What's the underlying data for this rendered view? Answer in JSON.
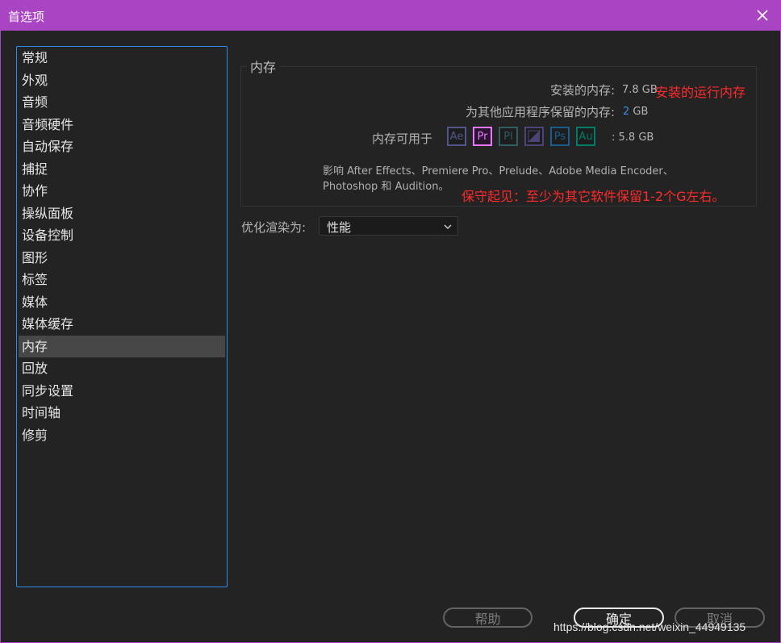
{
  "window": {
    "title": "首选项"
  },
  "sidebar": {
    "items": [
      {
        "label": "常规"
      },
      {
        "label": "外观"
      },
      {
        "label": "音频"
      },
      {
        "label": "音频硬件"
      },
      {
        "label": "自动保存"
      },
      {
        "label": "捕捉"
      },
      {
        "label": "协作"
      },
      {
        "label": "操纵面板"
      },
      {
        "label": "设备控制"
      },
      {
        "label": "图形"
      },
      {
        "label": "标签"
      },
      {
        "label": "媒体"
      },
      {
        "label": "媒体缓存"
      },
      {
        "label": "内存"
      },
      {
        "label": "回放"
      },
      {
        "label": "同步设置"
      },
      {
        "label": "时间轴"
      },
      {
        "label": "修剪"
      }
    ],
    "selected_index": 13
  },
  "memory": {
    "group_title": "内存",
    "installed_label": "安装的内存:",
    "installed_value": "7.8 GB",
    "reserved_label": "为其他应用程序保留的内存:",
    "reserved_value": "2",
    "reserved_unit": "GB",
    "available_label": "内存可用于",
    "available_value": ": 5.8 GB",
    "apps": [
      {
        "abbr": "Ae",
        "color": "#9999ff",
        "active": false,
        "icon": "after-effects-icon"
      },
      {
        "abbr": "Pr",
        "color": "#ea77ff",
        "active": true,
        "icon": "premiere-pro-icon"
      },
      {
        "abbr": "Pl",
        "color": "#59a9b3",
        "active": false,
        "icon": "prelude-icon"
      },
      {
        "abbr": "",
        "color": "#8b7bd8",
        "active": false,
        "icon": "media-encoder-icon"
      },
      {
        "abbr": "Ps",
        "color": "#31a8ff",
        "active": false,
        "icon": "photoshop-icon"
      },
      {
        "abbr": "Au",
        "color": "#00e4bb",
        "active": false,
        "icon": "audition-icon"
      }
    ],
    "affects_line1": "影响 After Effects、Premiere Pro、Prelude、Adobe Media Encoder、",
    "affects_line2": "Photoshop 和 Audition。"
  },
  "annotations": {
    "installed_note": "安装的运行内存",
    "reserve_note": "保守起见：至少为其它软件保留1-2个G左右。"
  },
  "optimize": {
    "label": "优化渲染为:",
    "value": "性能"
  },
  "buttons": {
    "help": "帮助",
    "ok": "确定",
    "cancel": "取消"
  },
  "watermark": "https://blog.csdn.net/weixin_44949135",
  "colors": {
    "titlebar": "#a944c2",
    "accent_blue": "#2d8ceb",
    "annotation_red": "#ff2a2a"
  }
}
